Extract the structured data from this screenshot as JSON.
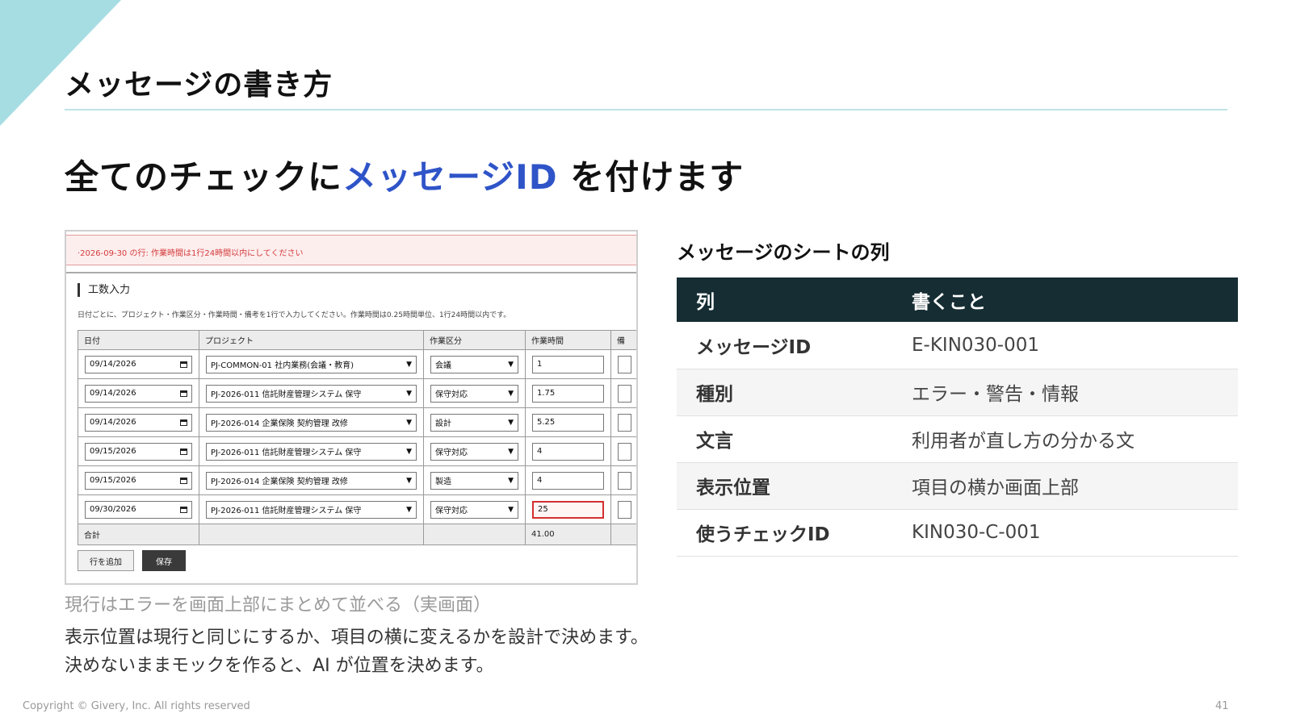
{
  "slide": {
    "title": "メッセージの書き方",
    "headline_pre": "全てのチェックに",
    "headline_accent": "メッセージID",
    "headline_post": " を付けます",
    "accent_color": "#2f54c8",
    "corner_color": "#a6dde3"
  },
  "screenshot": {
    "error_message": "·2026-09-30 の行: 作業時間は1行24時間以内にしてください",
    "form_title": "工数入力",
    "form_description": "日付ごとに、プロジェクト・作業区分・作業時間・備考を1行で入力してください。作業時間は0.25時間単位、1行24時間以内です。",
    "columns": [
      "日付",
      "プロジェクト",
      "作業区分",
      "作業時間",
      "備"
    ],
    "rows": [
      {
        "date": "09/14/2026",
        "project": "PJ-COMMON-01 社内業務(会議・教育)",
        "category": "会議",
        "hours": "1"
      },
      {
        "date": "09/14/2026",
        "project": "PJ-2026-011 信託財産管理システム 保守",
        "category": "保守対応",
        "hours": "1.75"
      },
      {
        "date": "09/14/2026",
        "project": "PJ-2026-014 企業保険 契約管理 改修",
        "category": "設計",
        "hours": "5.25"
      },
      {
        "date": "09/15/2026",
        "project": "PJ-2026-011 信託財産管理システム 保守",
        "category": "保守対応",
        "hours": "4"
      },
      {
        "date": "09/15/2026",
        "project": "PJ-2026-014 企業保険 契約管理 改修",
        "category": "製造",
        "hours": "4"
      },
      {
        "date": "09/30/2026",
        "project": "PJ-2026-011 信託財産管理システム 保守",
        "category": "保守対応",
        "hours": "25"
      }
    ],
    "total_label": "合計",
    "total_value": "41.00",
    "add_row_button": "行を追加",
    "save_button": "保存"
  },
  "caption": "現行はエラーを画面上部にまとめて並べる（実画面）",
  "body_lines": [
    "表示位置は現行と同じにするか、項目の横に変えるかを設計で決めます。",
    "決めないままモックを作ると、AI が位置を決めます。"
  ],
  "sheet": {
    "heading": "メッセージのシートの列",
    "header_col1": "列",
    "header_col2": "書くこと",
    "header_bg": "#152d33",
    "rows": [
      {
        "col": "メッセージID",
        "desc": "E-KIN030-001"
      },
      {
        "col": "種別",
        "desc": "エラー・警告・情報"
      },
      {
        "col": "文言",
        "desc": "利用者が直し方の分かる文"
      },
      {
        "col": "表示位置",
        "desc": "項目の横か画面上部"
      },
      {
        "col": "使うチェックID",
        "desc": "KIN030-C-001"
      }
    ]
  },
  "footer": {
    "copyright": "Copyright © Givery, Inc. All rights reserved",
    "page_number": "41"
  }
}
